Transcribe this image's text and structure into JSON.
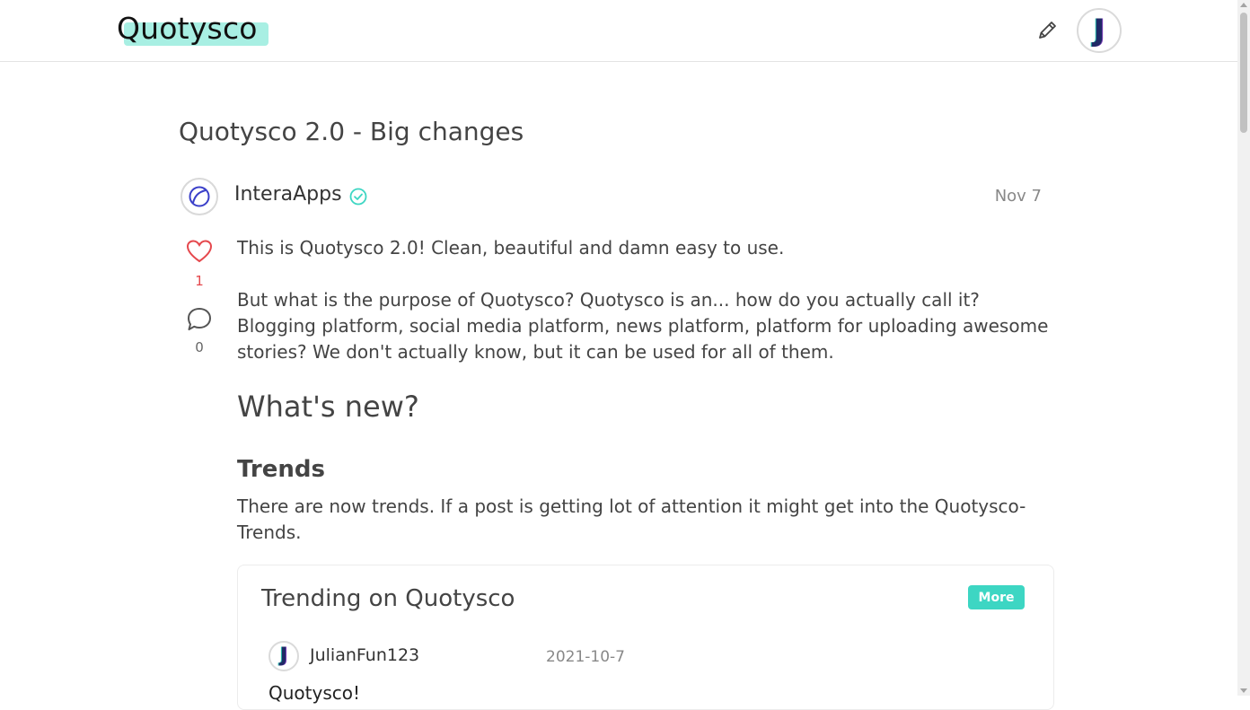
{
  "header": {
    "logo_text": "Quotysco",
    "user_avatar_letter": "J"
  },
  "post": {
    "title": "Quotysco 2.0 - Big changes",
    "author": "InteraApps",
    "date": "Nov 7",
    "likes": "1",
    "comments": "0",
    "paragraph_1": "This is Quotysco 2.0! Clean, beautiful and damn easy to use.",
    "paragraph_2": "But what is the purpose of Quotysco? Quotysco is an... how do you actually call it? Blogging platform, social media platform, news platform, platform for uploading awesome stories? We don't actually know, but it can be used for all of them.",
    "heading_whats_new": "What's new?",
    "heading_trends": "Trends",
    "paragraph_trends": "There are now trends. If a post is getting lot of attention it might get into the Quotysco-Trends."
  },
  "trending_card": {
    "title": "Trending on Quotysco",
    "more_label": "More",
    "items": [
      {
        "avatar_letter": "J",
        "user": "JulianFun123",
        "date": "2021-10-7",
        "post_title": "Quotysco!"
      }
    ]
  },
  "colors": {
    "accent": "#3dd6c3",
    "logo_highlight": "#a8efe3",
    "like": "#e5484d",
    "verified": "#3dd6c3"
  },
  "icons": [
    "pencil-icon",
    "heart-icon",
    "comment-icon",
    "verified-check-icon",
    "interaapps-logo-icon"
  ]
}
